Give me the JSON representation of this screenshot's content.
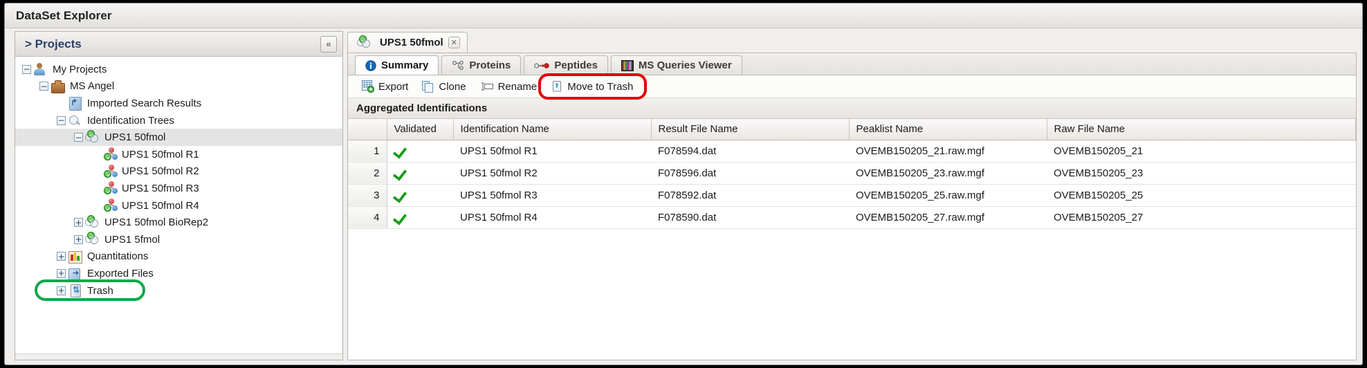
{
  "window": {
    "title": "DataSet Explorer"
  },
  "sidebar": {
    "header_label": "> Projects",
    "collapse_icon": "«",
    "tree": [
      {
        "label": "My Projects",
        "depth": 0,
        "toggle": "−",
        "icon": "person-icon",
        "selected": false
      },
      {
        "label": "MS Angel",
        "depth": 1,
        "toggle": "−",
        "icon": "briefcase-icon",
        "selected": false
      },
      {
        "label": "Imported Search Results",
        "depth": 2,
        "toggle": "",
        "icon": "import-icon",
        "selected": false
      },
      {
        "label": "Identification Trees",
        "depth": 2,
        "toggle": "−",
        "icon": "magnifier-icon",
        "selected": false
      },
      {
        "label": "UPS1 50fmol",
        "depth": 3,
        "toggle": "−",
        "icon": "id-tree-icon",
        "selected": true
      },
      {
        "label": "UPS1 50fmol R1",
        "depth": 4,
        "toggle": "",
        "icon": "molecule-icon",
        "selected": false
      },
      {
        "label": "UPS1 50fmol R2",
        "depth": 4,
        "toggle": "",
        "icon": "molecule-icon",
        "selected": false
      },
      {
        "label": "UPS1 50fmol R3",
        "depth": 4,
        "toggle": "",
        "icon": "molecule-icon",
        "selected": false
      },
      {
        "label": "UPS1 50fmol R4",
        "depth": 4,
        "toggle": "",
        "icon": "molecule-icon",
        "selected": false
      },
      {
        "label": "UPS1 50fmol BioRep2",
        "depth": 3,
        "toggle": "+",
        "icon": "id-tree-icon",
        "selected": false
      },
      {
        "label": "UPS1 5fmol",
        "depth": 3,
        "toggle": "+",
        "icon": "id-tree-icon",
        "selected": false
      },
      {
        "label": "Quantitations",
        "depth": 2,
        "toggle": "+",
        "icon": "bar-chart-icon",
        "selected": false
      },
      {
        "label": "Exported Files",
        "depth": 2,
        "toggle": "+",
        "icon": "exported-files-icon",
        "selected": false
      },
      {
        "label": "Trash",
        "depth": 2,
        "toggle": "+",
        "icon": "trash-icon",
        "selected": false
      }
    ],
    "highlight": {
      "target": "Trash",
      "color": "#0fa84a"
    }
  },
  "main": {
    "document_tab": {
      "label": "UPS1 50fmol",
      "icon": "id-tree-icon",
      "close_icon": "✕"
    },
    "sub_tabs": [
      {
        "label": "Summary",
        "icon": "info-icon",
        "active": true
      },
      {
        "label": "Proteins",
        "icon": "protein-icon",
        "active": false
      },
      {
        "label": "Peptides",
        "icon": "peptide-icon",
        "active": false
      },
      {
        "label": "MS Queries Viewer",
        "icon": "spectra-icon",
        "active": false
      }
    ],
    "toolbar": [
      {
        "label": "Export",
        "icon": "export-icon",
        "highlighted": false
      },
      {
        "label": "Clone",
        "icon": "clone-icon",
        "highlighted": false
      },
      {
        "label": "Rename",
        "icon": "rename-icon",
        "highlighted": false
      },
      {
        "label": "Move to Trash",
        "icon": "move-to-trash-icon",
        "highlighted": true
      }
    ],
    "toolbar_highlight_color": "#e00000",
    "section_title": "Aggregated Identifications",
    "table": {
      "columns": [
        "",
        "Validated",
        "Identification Name",
        "Result File Name",
        "Peaklist Name",
        "Raw File Name"
      ],
      "rows": [
        {
          "num": "1",
          "validated": "✔",
          "identification_name": "UPS1 50fmol R1",
          "result_file_name": "F078594.dat",
          "peaklist_name": "OVEMB150205_21.raw.mgf",
          "raw_file_name": "OVEMB150205_21"
        },
        {
          "num": "2",
          "validated": "✔",
          "identification_name": "UPS1 50fmol R2",
          "result_file_name": "F078596.dat",
          "peaklist_name": "OVEMB150205_23.raw.mgf",
          "raw_file_name": "OVEMB150205_23"
        },
        {
          "num": "3",
          "validated": "✔",
          "identification_name": "UPS1 50fmol R3",
          "result_file_name": "F078592.dat",
          "peaklist_name": "OVEMB150205_25.raw.mgf",
          "raw_file_name": "OVEMB150205_25"
        },
        {
          "num": "4",
          "validated": "✔",
          "identification_name": "UPS1 50fmol R4",
          "result_file_name": "F078590.dat",
          "peaklist_name": "OVEMB150205_27.raw.mgf",
          "raw_file_name": "OVEMB150205_27"
        }
      ]
    }
  }
}
